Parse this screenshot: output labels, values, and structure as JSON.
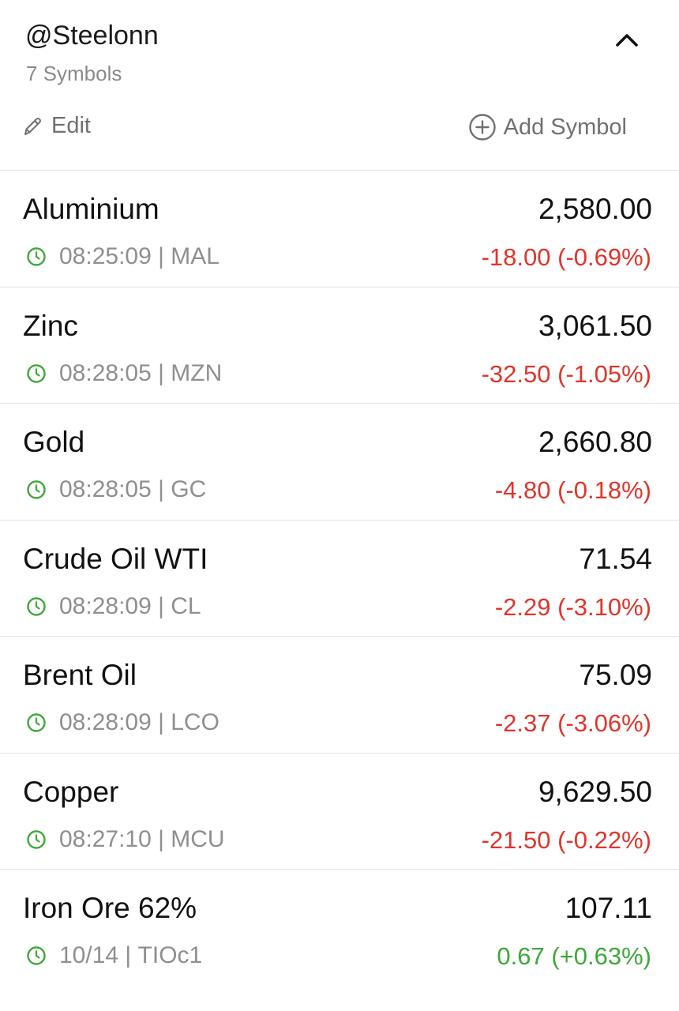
{
  "watchlist": {
    "title": "@Steelonn",
    "count_label": "7 Symbols",
    "edit_label": "Edit",
    "add_label": "Add Symbol"
  },
  "colors": {
    "negative": "#e0352b",
    "positive": "#3ea83a",
    "clock": "#3ea83a",
    "muted": "#8f8f8f"
  },
  "icons": {
    "collapse": "chevron-up-icon",
    "edit": "pencil-icon",
    "add": "plus-circle-icon",
    "time": "clock-icon"
  },
  "symbols": [
    {
      "name": "Aluminium",
      "price": "2,580.00",
      "time": "08:25:09",
      "code": "MAL",
      "change": "-18.00 (-0.69%)",
      "direction": "negative"
    },
    {
      "name": "Zinc",
      "price": "3,061.50",
      "time": "08:28:05",
      "code": "MZN",
      "change": "-32.50 (-1.05%)",
      "direction": "negative"
    },
    {
      "name": "Gold",
      "price": "2,660.80",
      "time": "08:28:05",
      "code": "GC",
      "change": "-4.80 (-0.18%)",
      "direction": "negative"
    },
    {
      "name": "Crude Oil WTI",
      "price": "71.54",
      "time": "08:28:09",
      "code": "CL",
      "change": "-2.29 (-3.10%)",
      "direction": "negative"
    },
    {
      "name": "Brent Oil",
      "price": "75.09",
      "time": "08:28:09",
      "code": "LCO",
      "change": "-2.37 (-3.06%)",
      "direction": "negative"
    },
    {
      "name": "Copper",
      "price": "9,629.50",
      "time": "08:27:10",
      "code": "MCU",
      "change": "-21.50 (-0.22%)",
      "direction": "negative"
    },
    {
      "name": "Iron Ore 62%",
      "price": "107.11",
      "time": "10/14",
      "code": "TIOc1",
      "change": "0.67 (+0.63%)",
      "direction": "positive"
    }
  ]
}
